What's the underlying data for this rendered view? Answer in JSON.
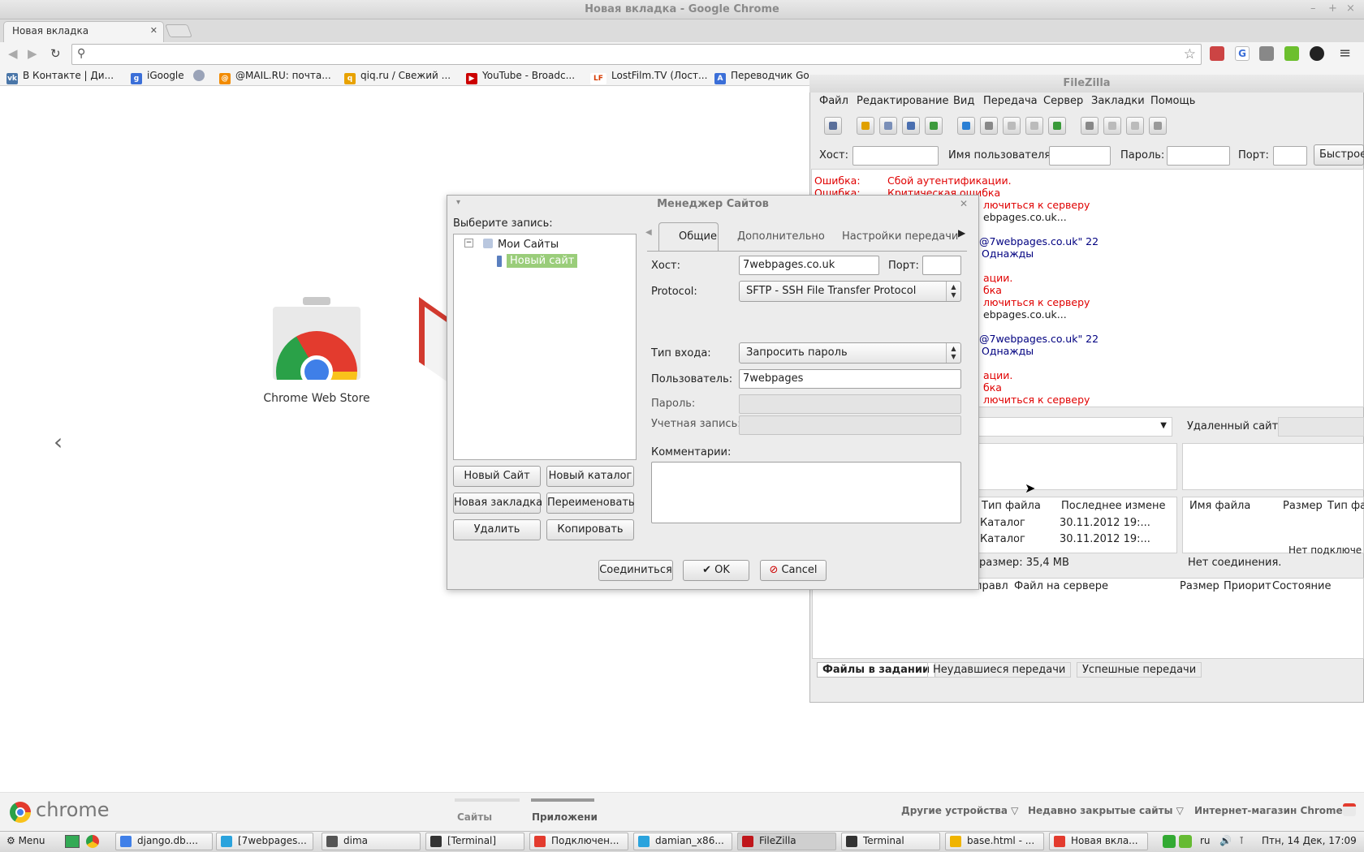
{
  "chrome": {
    "window_title": "Новая вкладка - Google Chrome",
    "tab_title": "Новая вкладка",
    "bookmarks": [
      {
        "label": "В Контакте | Ди...",
        "icon": "vk-icon",
        "color": "#4a76a8"
      },
      {
        "label": "iGoogle",
        "icon": "google-icon",
        "color": "#3b6fd8"
      },
      {
        "label": "",
        "icon": "globe-icon",
        "color": "#9aa3b8"
      },
      {
        "label": "@MAIL.RU: почта...",
        "icon": "mailru-icon",
        "color": "#f28b00"
      },
      {
        "label": "qiq.ru / Свежий ...",
        "icon": "qiq-icon",
        "color": "#e8a200"
      },
      {
        "label": "YouTube - Broadc...",
        "icon": "youtube-icon",
        "color": "#cc0000"
      },
      {
        "label": "LostFilm.TV (Лост...",
        "icon": "lostfilm-icon",
        "color": "#d63b00"
      },
      {
        "label": "Переводчик Go",
        "icon": "translate-icon",
        "color": "#3b6fd8"
      }
    ],
    "ntp": {
      "app_label": "Chrome Web Store",
      "prev_arrow": "‹",
      "logo_word": "chrome",
      "tabs": [
        "Сайты",
        "Приложени"
      ],
      "footer_links": [
        "Другие устройства ▽",
        "Недавно закрытые сайты ▽",
        "Интернет-магазин Chrome"
      ]
    }
  },
  "filezilla": {
    "title": "FileZilla",
    "menu": [
      "Файл",
      "Редактирование",
      "Вид",
      "Передача",
      "Сервер",
      "Закладки",
      "Помощь"
    ],
    "quickconnect": {
      "host_label": "Хост:",
      "user_label": "Имя пользователя",
      "pass_label": "Пароль:",
      "port_label": "Порт:",
      "button": "Быстрое"
    },
    "log": [
      {
        "left": "Ошибка:",
        "text": "Сбой аутентификации.",
        "cls": "red"
      },
      {
        "left": "Ошибка:",
        "text": "Критическая ошибка",
        "cls": "red"
      },
      {
        "left": "",
        "text": "лючиться к серверу",
        "cls": "red"
      },
      {
        "left": "",
        "text": "ebpages.co.uk...",
        "cls": "black"
      },
      {
        "left": "",
        "text": "",
        "cls": "black"
      },
      {
        "left": "",
        "text": "@7webpages.co.uk\" 22",
        "cls": "blue"
      },
      {
        "left": "",
        "text": "Однажды",
        "cls": "blue"
      },
      {
        "left": "",
        "text": "",
        "cls": "black"
      },
      {
        "left": "",
        "text": "ации.",
        "cls": "red"
      },
      {
        "left": "",
        "text": "бка",
        "cls": "red"
      },
      {
        "left": "",
        "text": "лючиться к серверу",
        "cls": "red"
      },
      {
        "left": "",
        "text": "ebpages.co.uk...",
        "cls": "black"
      },
      {
        "left": "",
        "text": "",
        "cls": "black"
      },
      {
        "left": "",
        "text": "@7webpages.co.uk\" 22",
        "cls": "blue"
      },
      {
        "left": "",
        "text": "Однажды",
        "cls": "blue"
      },
      {
        "left": "",
        "text": "",
        "cls": "black"
      },
      {
        "left": "",
        "text": "ации.",
        "cls": "red"
      },
      {
        "left": "",
        "text": "бка",
        "cls": "red"
      },
      {
        "left": "",
        "text": "лючиться к серверу",
        "cls": "red"
      }
    ],
    "remote_site_label": "Удаленный сайт:",
    "local_cols": [
      "Тип файла",
      "Последнее измене"
    ],
    "local_rows": [
      {
        "type": "Каталог",
        "date": "30.11.2012 19:..."
      },
      {
        "type": "Каталог",
        "date": "30.11.2012 19:..."
      }
    ],
    "local_status": "размер: 35,4 MB",
    "remote_cols": [
      "Имя файла",
      "Размер",
      "Тип файла"
    ],
    "remote_empty": "Нет подключе",
    "remote_status": "Нет соединения.",
    "queue_cols": [
      "правл",
      "Файл на сервере",
      "Размер",
      "Приорит",
      "Состояние"
    ],
    "queue_tabs": [
      "Файлы в задании",
      "Неудавшиеся передачи",
      "Успешные передачи"
    ]
  },
  "site_manager": {
    "title": "Менеджер Сайтов",
    "select_label": "Выберите запись:",
    "tree_root": "Мои Сайты",
    "tree_item": "Новый сайт",
    "tabs": [
      "Общие",
      "Дополнительно",
      "Настройки передачи"
    ],
    "host_label": "Хост:",
    "host_value": "7webpages.co.uk",
    "port_label": "Порт:",
    "port_value": "",
    "protocol_label": "Protocol:",
    "protocol_value": "SFTP - SSH File Transfer Protocol",
    "logon_label": "Тип входа:",
    "logon_value": "Запросить пароль",
    "user_label": "Пользователь:",
    "user_value": "7webpages",
    "password_label": "Пароль:",
    "account_label": "Учетная запись:",
    "comments_label": "Комментарии:",
    "buttons": {
      "new_site": "Новый Сайт",
      "new_folder": "Новый каталог",
      "new_bookmark": "Новая закладка",
      "rename": "Переименовать",
      "delete": "Удалить",
      "copy": "Копировать"
    },
    "footer": {
      "connect": "Соединиться",
      "ok": "OK",
      "cancel": "Cancel"
    }
  },
  "taskbar": {
    "menu": "Menu",
    "items": [
      {
        "label": "django.db....",
        "color": "#3f7fe8"
      },
      {
        "label": "[7webpages...",
        "color": "#2aa3dd"
      },
      {
        "label": "dima",
        "color": "#555"
      },
      {
        "label": "[Terminal]",
        "color": "#333"
      },
      {
        "label": "Подключен...",
        "color": "#e33b2e"
      },
      {
        "label": "damian_x86...",
        "color": "#2aa3dd"
      },
      {
        "label": "FileZilla",
        "color": "#c0161b"
      },
      {
        "label": "Terminal",
        "color": "#333"
      },
      {
        "label": "base.html - ...",
        "color": "#f0b400"
      },
      {
        "label": "Новая вкла...",
        "color": "#e33b2e"
      }
    ],
    "lang": "ru",
    "clock": "Птн, 14 Дек, 17:09"
  }
}
